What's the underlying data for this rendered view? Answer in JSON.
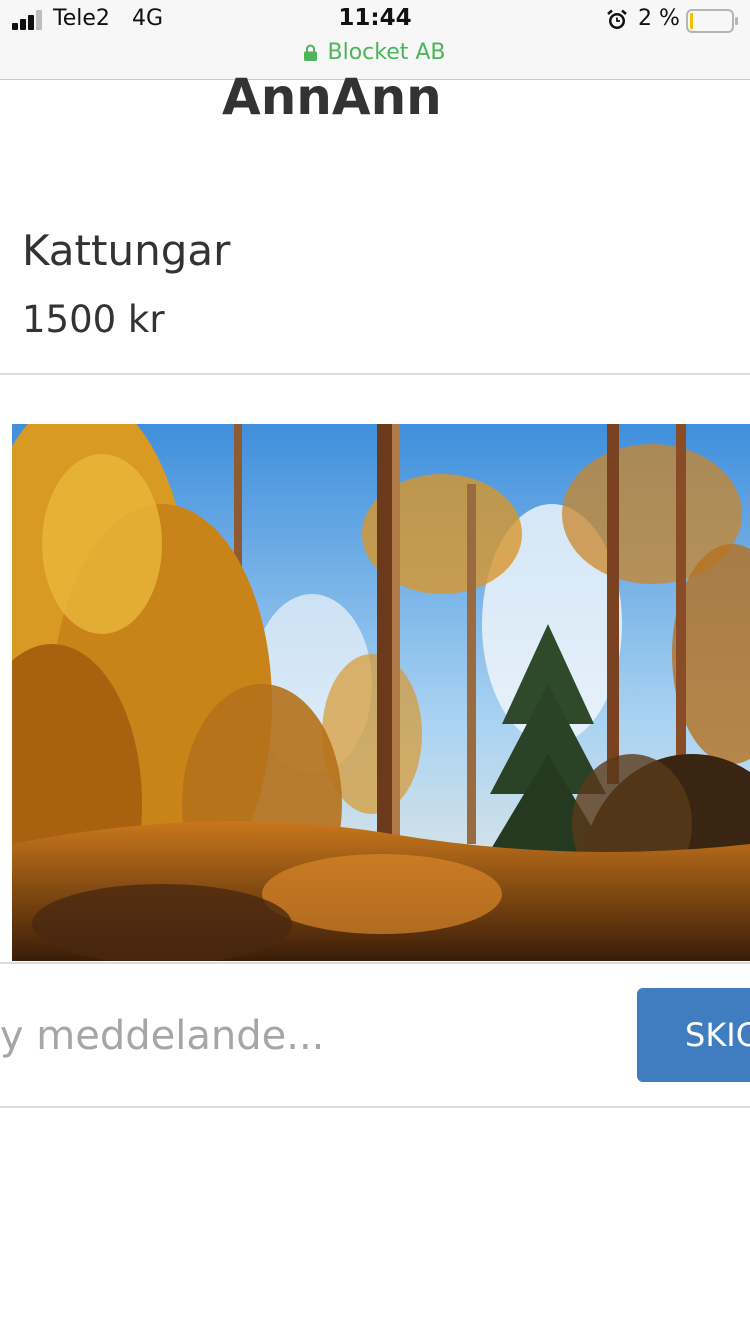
{
  "status_bar": {
    "carrier": "Tele2",
    "network": "4G",
    "time": "11:44",
    "battery_percent": "2 %",
    "site_name": "Blocket AB",
    "icons": [
      "signal-icon",
      "alarm-icon",
      "battery-icon",
      "lock-icon"
    ],
    "site_color": "#4cb55b"
  },
  "conversation": {
    "seller_name": "AnnAnn",
    "ad_title": "Kattungar",
    "ad_price": "1500 kr"
  },
  "composer": {
    "placeholder": "Ny meddelande...",
    "send_label": "SKICKA",
    "send_color": "#3f7dc0"
  }
}
